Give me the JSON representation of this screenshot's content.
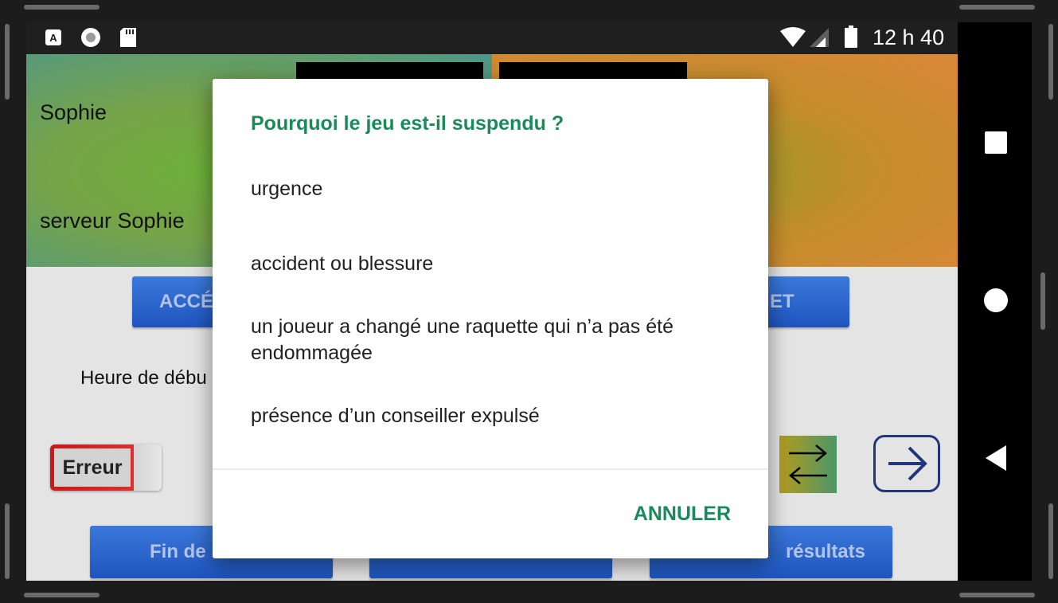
{
  "status_bar": {
    "time": "12 h 40",
    "icons": [
      "a-notification-icon",
      "record-icon",
      "sd-card-icon",
      "wifi-icon",
      "signal-icon",
      "battery-icon"
    ]
  },
  "nav_bar": {
    "icons": [
      "recents-square-icon",
      "home-circle-icon",
      "back-triangle-icon"
    ]
  },
  "scoreboard": {
    "left_player": "Sophie",
    "left_server": "serveur Sophie"
  },
  "app": {
    "accel_button": "ACCÉL",
    "right_button_fragment": "ET",
    "start_time_label": "Heure de débu",
    "error_toggle": "Erreur",
    "end_game_button": "Fin de",
    "results_button": "résultats"
  },
  "dialog": {
    "title": "Pourquoi le jeu est-il suspendu ?",
    "options": [
      "urgence",
      "accident ou blessure",
      "un joueur a changé une raquette qui n’a pas été endommagée",
      "présence d’un conseiller expulsé"
    ],
    "cancel": "ANNULER"
  },
  "colors": {
    "accent": "#1a8a5a",
    "button_blue": "#2a63cc"
  }
}
